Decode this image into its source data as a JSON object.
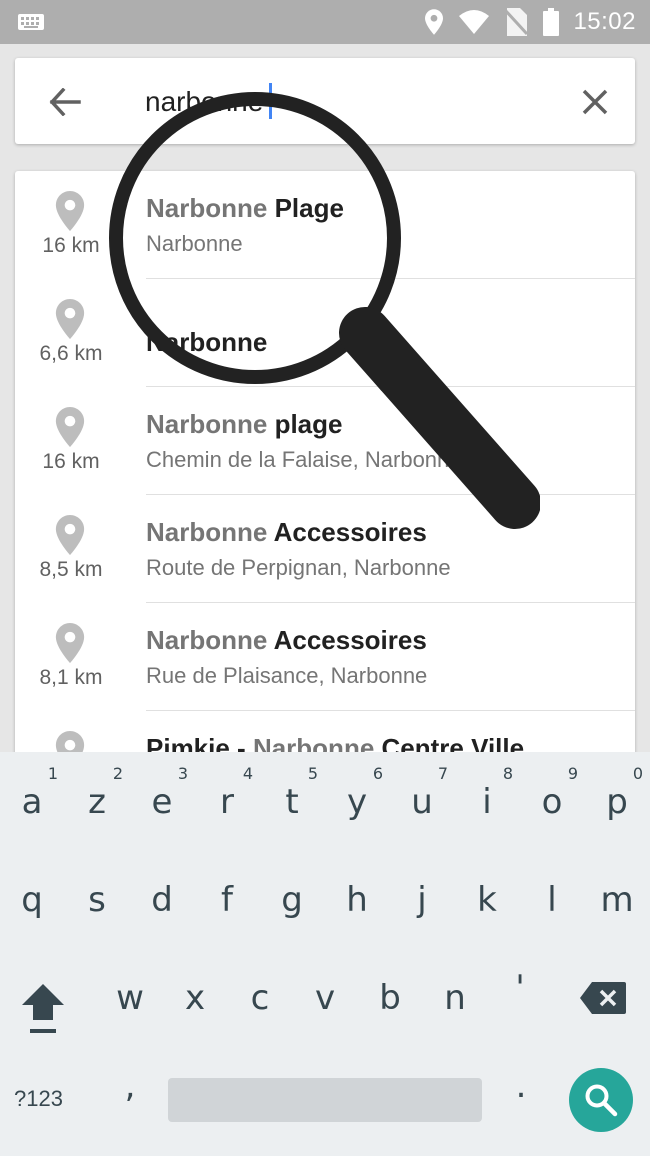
{
  "status_bar": {
    "time": "15:02"
  },
  "search": {
    "value": "narbonne"
  },
  "results": [
    {
      "distance": "16 km",
      "title_match": "Narbonne",
      "title_rest": " Plage",
      "subtitle": "Narbonne"
    },
    {
      "distance": "6,6 km",
      "title_match": "",
      "title_rest": "Narbonne",
      "subtitle": ""
    },
    {
      "distance": "16 km",
      "title_match": "Narbonne",
      "title_rest": " plage",
      "subtitle": "Chemin de la Falaise, Narbonne"
    },
    {
      "distance": "8,5 km",
      "title_match": "Narbonne",
      "title_rest": " Accessoires",
      "subtitle": "Route de Perpignan, Narbonne"
    },
    {
      "distance": "8,1 km",
      "title_match": "Narbonne",
      "title_rest": " Accessoires",
      "subtitle": "Rue de Plaisance, Narbonne"
    },
    {
      "distance": "",
      "title_prefix": "Pimkie - ",
      "title_match": "Narbonne",
      "title_rest": " Centre Ville",
      "subtitle": ""
    }
  ],
  "keyboard": {
    "row1": [
      {
        "key": "a",
        "hint": "1"
      },
      {
        "key": "z",
        "hint": "2"
      },
      {
        "key": "e",
        "hint": "3"
      },
      {
        "key": "r",
        "hint": "4"
      },
      {
        "key": "t",
        "hint": "5"
      },
      {
        "key": "y",
        "hint": "6"
      },
      {
        "key": "u",
        "hint": "7"
      },
      {
        "key": "i",
        "hint": "8"
      },
      {
        "key": "o",
        "hint": "9"
      },
      {
        "key": "p",
        "hint": "0"
      }
    ],
    "row2": [
      "q",
      "s",
      "d",
      "f",
      "g",
      "h",
      "j",
      "k",
      "l",
      "m"
    ],
    "row3": [
      "w",
      "x",
      "c",
      "v",
      "b",
      "n",
      "'"
    ],
    "symbols_label": "?123",
    "comma": ",",
    "period": "."
  },
  "colors": {
    "accent": "#4285f4",
    "search_key": "#26a69a",
    "status_bar": "#aeaeae"
  }
}
